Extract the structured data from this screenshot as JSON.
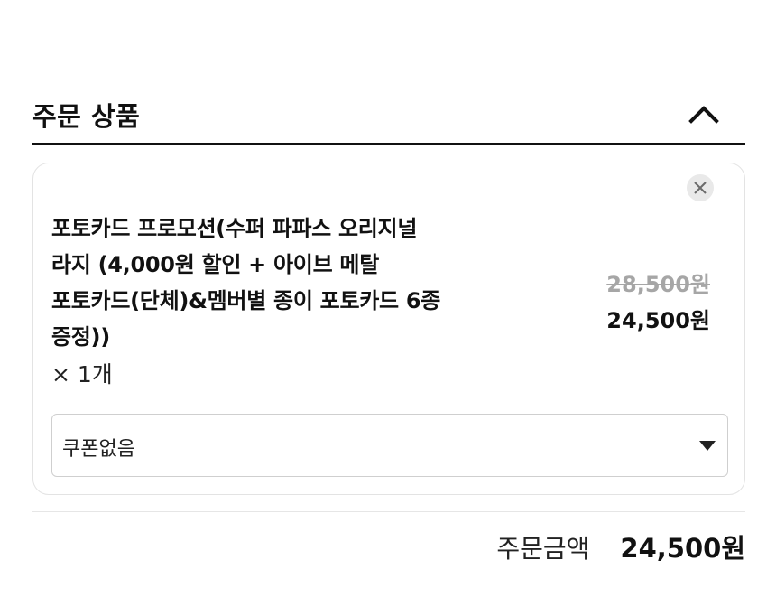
{
  "section": {
    "title": "주문 상품"
  },
  "item": {
    "name": "포토카드 프로모션(수퍼 파파스 오리지널 라지 (4,000원 할인 + 아이브 메탈 포토카드(단체)&멤버별 종이 포토카드 6종 증정))",
    "quantity": "× 1개",
    "original_price": "28,500원",
    "sale_price": "24,500원",
    "coupon": {
      "selected": "쿠폰없음"
    }
  },
  "summary": {
    "total_label": "주문금액",
    "total_value": "24,500원"
  },
  "icons": {
    "collapse": "chevron-up-icon",
    "remove": "close-icon",
    "dropdown": "caret-down-icon"
  },
  "colors": {
    "text": "#111111",
    "strikethrough": "#a6a6a6",
    "card_border": "#e3e3e3",
    "remove_bg": "#e9e9e9"
  }
}
